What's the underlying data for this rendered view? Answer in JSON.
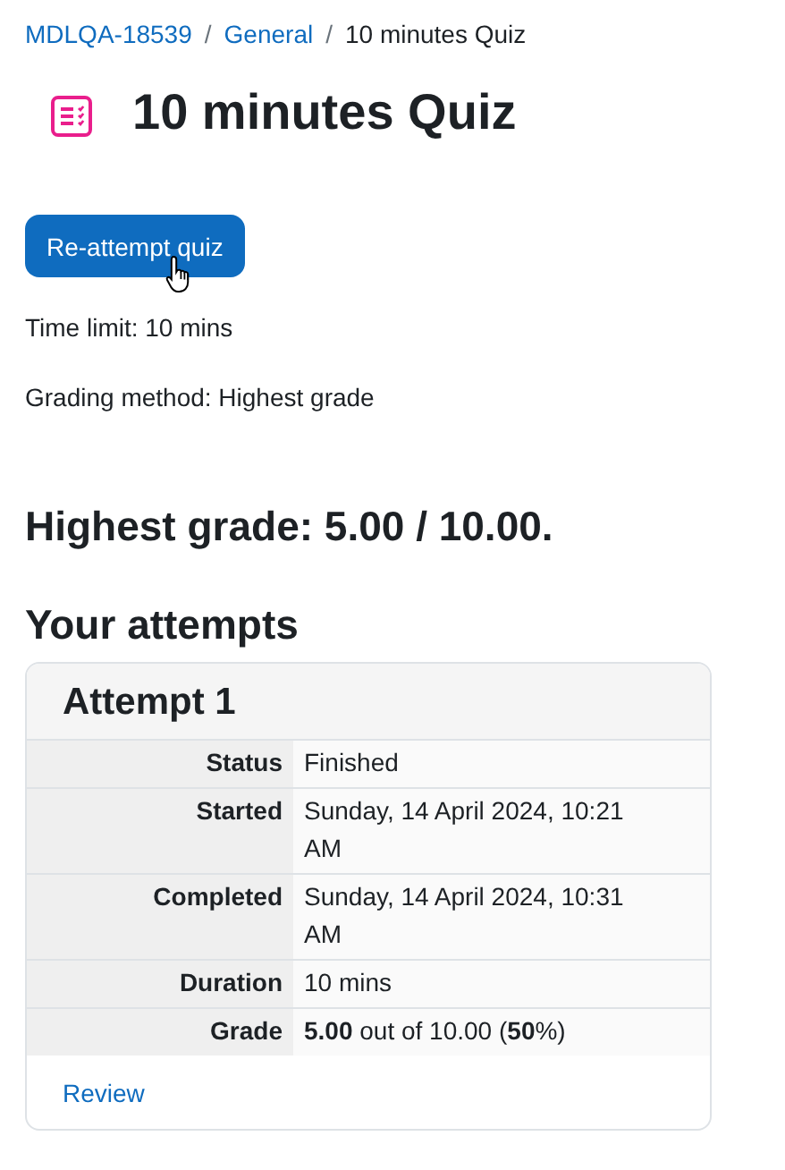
{
  "breadcrumb": [
    {
      "label": "MDLQA-18539",
      "link": true
    },
    {
      "separator": "/"
    },
    {
      "label": "General",
      "link": true
    },
    {
      "separator": "/"
    },
    {
      "label": "10 minutes Quiz",
      "link": false
    }
  ],
  "title": "10 minutes Quiz",
  "button": "Re-attempt quiz",
  "info": [
    "Time limit: 10 mins",
    "Grading method: Highest grade"
  ],
  "highest_grade": "Highest grade: 5.00 / 10.00.",
  "attempts_heading": "Your attempts",
  "attempt": {
    "title": "Attempt 1",
    "rows": [
      {
        "label": "Status",
        "value": "Finished"
      },
      {
        "label": "Started",
        "value": "Sunday, 14 April 2024, 10:21 AM"
      },
      {
        "label": "Completed",
        "value": "Sunday, 14 April 2024, 10:31 AM"
      },
      {
        "label": "Duration",
        "value": "10 mins"
      },
      {
        "label": "Grade",
        "value": "**5.00** out of 10.00 (**50**%)"
      }
    ],
    "link": "Review"
  }
}
